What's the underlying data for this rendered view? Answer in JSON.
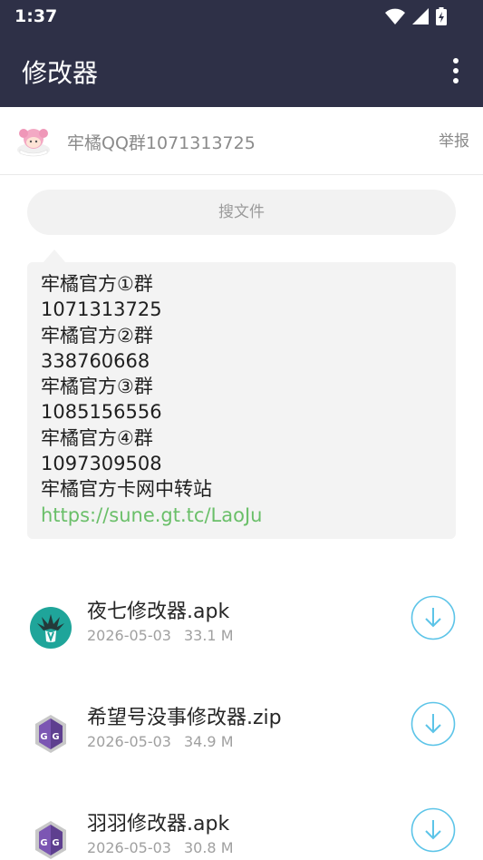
{
  "status_bar": {
    "time": "1:37"
  },
  "app_bar": {
    "title": "修改器"
  },
  "group": {
    "name": "牢橘QQ群1071313725",
    "report_label": "举报"
  },
  "search": {
    "placeholder": "搜文件"
  },
  "notice": {
    "lines": [
      "牢橘官方①群",
      "1071313725",
      "牢橘官方②群",
      "338760668",
      "牢橘官方③群",
      "1085156556",
      "牢橘官方④群",
      "1097309508",
      "牢橘官方卡网中转站"
    ],
    "link": "https://sune.gt.tc/LaoJu"
  },
  "files": [
    {
      "name": "夜七修改器.apk",
      "date": "2026-05-03",
      "size": "33.1 M",
      "icon": "magisk-icon"
    },
    {
      "name": "希望号没事修改器.zip",
      "date": "2026-05-03",
      "size": "34.9 M",
      "icon": "game-guardian-icon"
    },
    {
      "name": "羽羽修改器.apk",
      "date": "2026-05-03",
      "size": "30.8 M",
      "icon": "game-guardian-icon"
    }
  ],
  "colors": {
    "app_bar": "#2e3047",
    "accent": "#5cc4e8",
    "link": "#6abf69"
  }
}
